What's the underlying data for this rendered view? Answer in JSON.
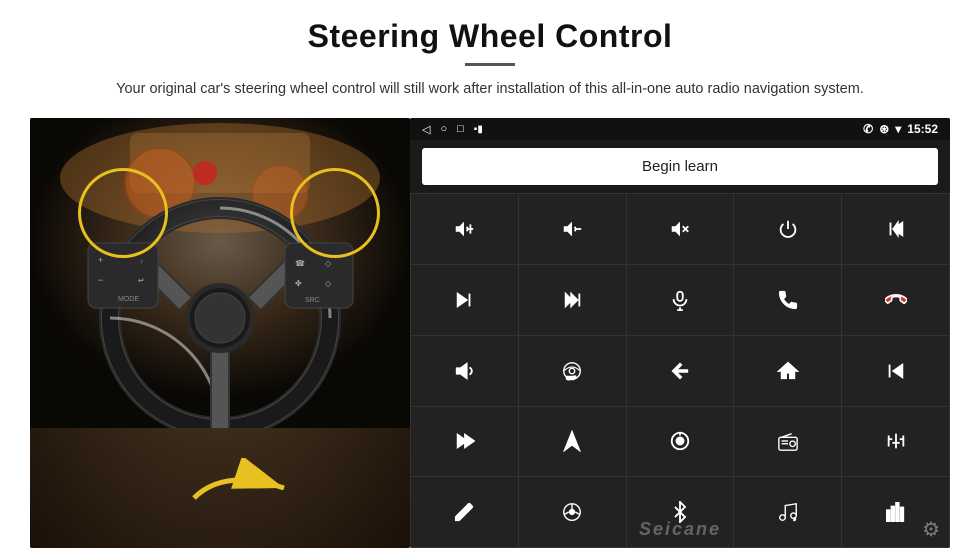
{
  "page": {
    "title": "Steering Wheel Control",
    "subtitle": "Your original car's steering wheel control will still work after installation of this all-in-one auto radio navigation system.",
    "divider": true
  },
  "status_bar": {
    "nav_back": "◁",
    "nav_home": "○",
    "nav_square": "□",
    "signal_icon": "▪▪",
    "phone_icon": "📞",
    "location_icon": "⊛",
    "wifi_icon": "▾",
    "time": "15:52"
  },
  "begin_learn": {
    "label": "Begin learn"
  },
  "controls": [
    {
      "id": "vol-up",
      "icon": "vol_up"
    },
    {
      "id": "vol-down",
      "icon": "vol_down"
    },
    {
      "id": "vol-mute",
      "icon": "vol_mute"
    },
    {
      "id": "power",
      "icon": "power"
    },
    {
      "id": "prev-track",
      "icon": "prev_track"
    },
    {
      "id": "next-track",
      "icon": "next_track"
    },
    {
      "id": "seek-fwd",
      "icon": "seek_fwd"
    },
    {
      "id": "mic",
      "icon": "mic"
    },
    {
      "id": "phone",
      "icon": "phone"
    },
    {
      "id": "hang-up",
      "icon": "hang_up"
    },
    {
      "id": "horn",
      "icon": "horn"
    },
    {
      "id": "360-cam",
      "icon": "cam_360"
    },
    {
      "id": "back",
      "icon": "back"
    },
    {
      "id": "home",
      "icon": "home"
    },
    {
      "id": "prev-track2",
      "icon": "prev_track2"
    },
    {
      "id": "fast-fwd",
      "icon": "fast_fwd"
    },
    {
      "id": "navigate",
      "icon": "navigate"
    },
    {
      "id": "source",
      "icon": "source"
    },
    {
      "id": "radio",
      "icon": "radio"
    },
    {
      "id": "settings-eq",
      "icon": "eq"
    },
    {
      "id": "pen",
      "icon": "pen"
    },
    {
      "id": "steering",
      "icon": "steering"
    },
    {
      "id": "bluetooth",
      "icon": "bluetooth"
    },
    {
      "id": "music",
      "icon": "music"
    },
    {
      "id": "spectrum",
      "icon": "spectrum"
    }
  ],
  "watermark": {
    "text": "Seicane"
  }
}
